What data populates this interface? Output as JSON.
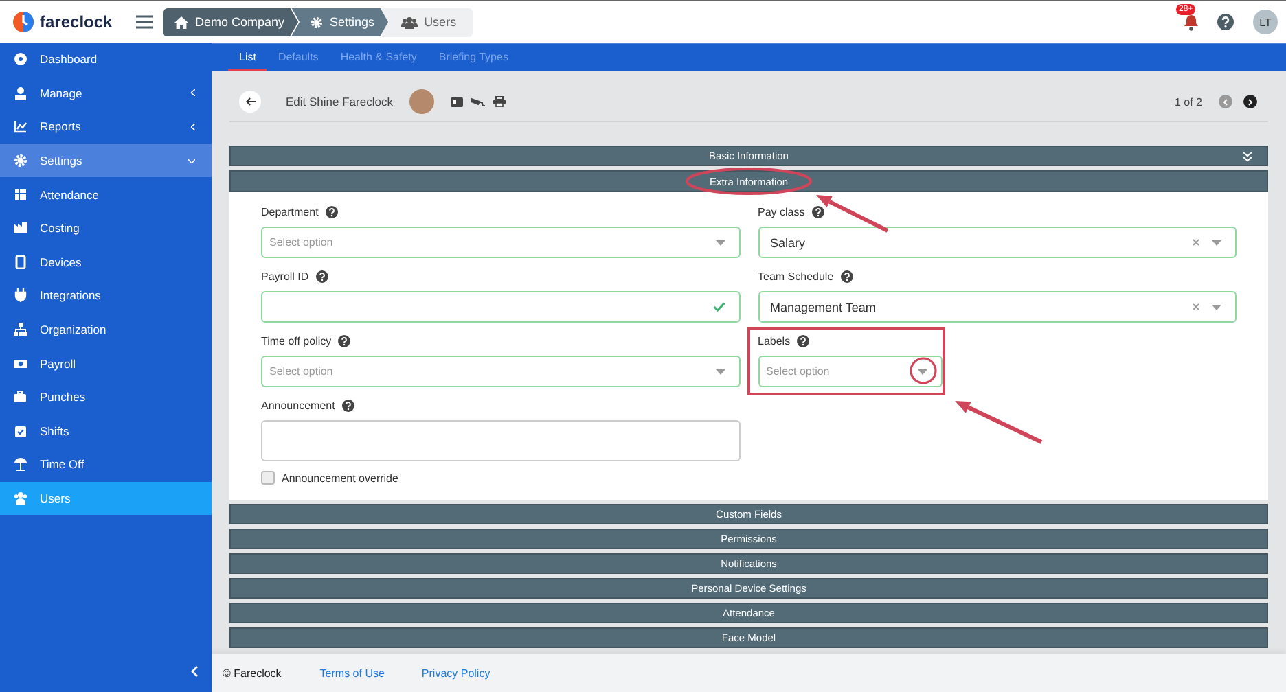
{
  "brand": {
    "name": "fareclock"
  },
  "breadcrumbs": [
    {
      "label": "Demo Company",
      "kind": "home"
    },
    {
      "label": "Settings",
      "kind": "gear"
    },
    {
      "label": "Users",
      "kind": "users"
    }
  ],
  "header": {
    "notifications_badge": "28+",
    "avatar_initials": "LT"
  },
  "sidebar": {
    "items": [
      {
        "label": "Dashboard",
        "selected": false
      },
      {
        "label": "Manage",
        "selected": false,
        "expanded": false
      },
      {
        "label": "Reports",
        "selected": false,
        "expanded": false
      },
      {
        "label": "Settings",
        "selected": false,
        "expanded": true,
        "children": [
          {
            "label": "Attendance",
            "selected": false
          },
          {
            "label": "Costing",
            "selected": false
          },
          {
            "label": "Devices",
            "selected": false
          },
          {
            "label": "Integrations",
            "selected": false
          },
          {
            "label": "Organization",
            "selected": false
          },
          {
            "label": "Payroll",
            "selected": false
          },
          {
            "label": "Punches",
            "selected": false
          },
          {
            "label": "Shifts",
            "selected": false
          },
          {
            "label": "Time Off",
            "selected": false
          },
          {
            "label": "Users",
            "selected": true
          }
        ]
      }
    ]
  },
  "tabs": [
    {
      "label": "List",
      "selected": true
    },
    {
      "label": "Defaults",
      "selected": false
    },
    {
      "label": "Health & Safety",
      "selected": false
    },
    {
      "label": "Briefing Types",
      "selected": false
    }
  ],
  "toolbar": {
    "title": "Edit Shine Fareclock",
    "pager": "1 of 2"
  },
  "sections": [
    {
      "title": "Basic Information",
      "expanded": false
    },
    {
      "title": "Extra Information",
      "expanded": true
    },
    {
      "title": "Custom Fields",
      "expanded": false
    },
    {
      "title": "Permissions",
      "expanded": false
    },
    {
      "title": "Notifications",
      "expanded": false
    },
    {
      "title": "Personal Device Settings",
      "expanded": false
    },
    {
      "title": "Attendance",
      "expanded": false
    },
    {
      "title": "Face Model",
      "expanded": false
    }
  ],
  "form": {
    "left": [
      {
        "kind": "select",
        "label": "Department",
        "placeholder": "Select option",
        "valid": true
      },
      {
        "kind": "text",
        "label": "Payroll ID",
        "valid": true
      },
      {
        "kind": "select",
        "label": "Time off policy",
        "placeholder": "Select option",
        "valid": true
      },
      {
        "kind": "textarea",
        "label": "Announcement",
        "valid": false
      },
      {
        "kind": "checkbox",
        "label": "Announcement override",
        "checked": false
      }
    ],
    "right": [
      {
        "kind": "select",
        "label": "Pay class",
        "value": "Salary",
        "clearable": true,
        "valid": true
      },
      {
        "kind": "select",
        "label": "Team Schedule",
        "value": "Management Team",
        "clearable": true,
        "valid": true
      },
      {
        "kind": "select",
        "label": "Labels",
        "placeholder": "Select option",
        "valid": true,
        "compact": true
      }
    ]
  },
  "footer": {
    "copyright": "© Fareclock",
    "links": [
      "Terms of Use",
      "Privacy Policy"
    ]
  },
  "annotations": [
    {
      "kind": "ellipse"
    },
    {
      "kind": "arrow"
    },
    {
      "kind": "box"
    },
    {
      "kind": "circle"
    },
    {
      "kind": "arrow"
    }
  ]
}
